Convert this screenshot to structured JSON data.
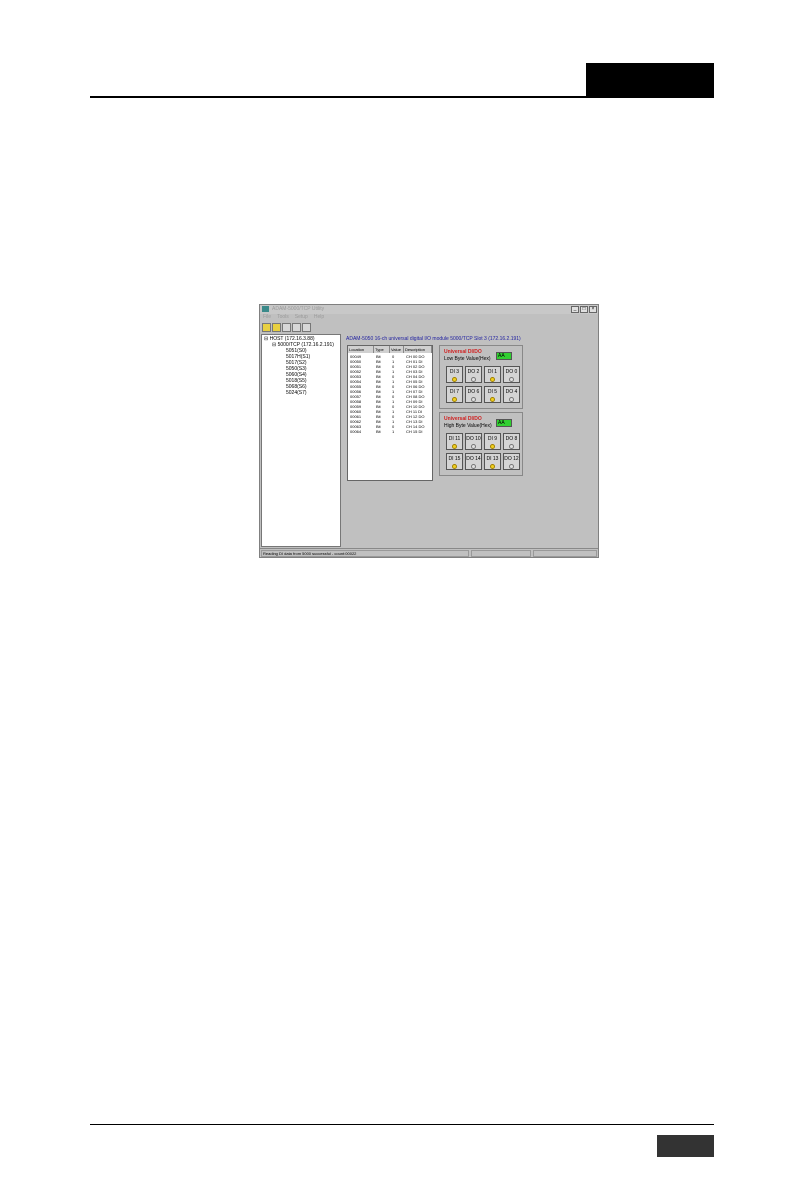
{
  "window": {
    "title": "ADAM-5000/TCP Utility",
    "menu": [
      "File",
      "Tools",
      "Setup",
      "Help"
    ],
    "controls": [
      "_",
      "□",
      "×"
    ]
  },
  "tree": {
    "root": "HOST (172.16.3.88)",
    "device": "5000/TCP (172.16.2.191)",
    "modules": [
      "5051(S0)",
      "5017H(S1)",
      "5017(S2)",
      "5050(S3)",
      "5060(S4)",
      "5018(S5)",
      "5068(S6)",
      "5024(S7)"
    ]
  },
  "main": {
    "module_title": "ADAM-5050 16-ch universal digital I/O module    5000/TCP Slot 3 (172.16.2.191)",
    "table": {
      "columns": [
        "Location",
        "Type",
        "Value",
        "Description"
      ],
      "rows": [
        [
          "00049",
          "Bit",
          "0",
          "CH 00 DO"
        ],
        [
          "00050",
          "Bit",
          "1",
          "CH 01 DI"
        ],
        [
          "00051",
          "Bit",
          "0",
          "CH 02 DO"
        ],
        [
          "00052",
          "Bit",
          "1",
          "CH 03 DI"
        ],
        [
          "00053",
          "Bit",
          "0",
          "CH 04 DO"
        ],
        [
          "00054",
          "Bit",
          "1",
          "CH 05 DI"
        ],
        [
          "00055",
          "Bit",
          "0",
          "CH 06 DO"
        ],
        [
          "00056",
          "Bit",
          "1",
          "CH 07 DI"
        ],
        [
          "00057",
          "Bit",
          "0",
          "CH 08 DO"
        ],
        [
          "00058",
          "Bit",
          "1",
          "CH 09 DI"
        ],
        [
          "00059",
          "Bit",
          "0",
          "CH 10 DO"
        ],
        [
          "00060",
          "Bit",
          "1",
          "CH 11 DI"
        ],
        [
          "00061",
          "Bit",
          "0",
          "CH 12 DO"
        ],
        [
          "00062",
          "Bit",
          "1",
          "CH 13 DI"
        ],
        [
          "00063",
          "Bit",
          "0",
          "CH 14 DO"
        ],
        [
          "00064",
          "Bit",
          "1",
          "CH 15 DI"
        ]
      ]
    },
    "low_group": {
      "title": "Universal DI/DO",
      "label": "Low Byte Value(Hex)",
      "value": "AA",
      "buttons": [
        {
          "label": "DI 3",
          "on": true
        },
        {
          "label": "DO 2",
          "on": false
        },
        {
          "label": "DI 1",
          "on": true
        },
        {
          "label": "DO 0",
          "on": false
        },
        {
          "label": "DI 7",
          "on": true
        },
        {
          "label": "DO 6",
          "on": false
        },
        {
          "label": "DI 5",
          "on": true
        },
        {
          "label": "DO 4",
          "on": false
        }
      ]
    },
    "high_group": {
      "title": "Universal DI/DO",
      "label": "High Byte Value(Hex)",
      "value": "AA",
      "buttons": [
        {
          "label": "DI 11",
          "on": true
        },
        {
          "label": "DO 10",
          "on": false
        },
        {
          "label": "DI 9",
          "on": true
        },
        {
          "label": "DO 8",
          "on": false
        },
        {
          "label": "DI 15",
          "on": true
        },
        {
          "label": "DO 14",
          "on": false
        },
        {
          "label": "DI 13",
          "on": true
        },
        {
          "label": "DO 12",
          "on": false
        }
      ]
    }
  },
  "status": {
    "message": "Reading DI data from 5000 successful - count:00022"
  }
}
